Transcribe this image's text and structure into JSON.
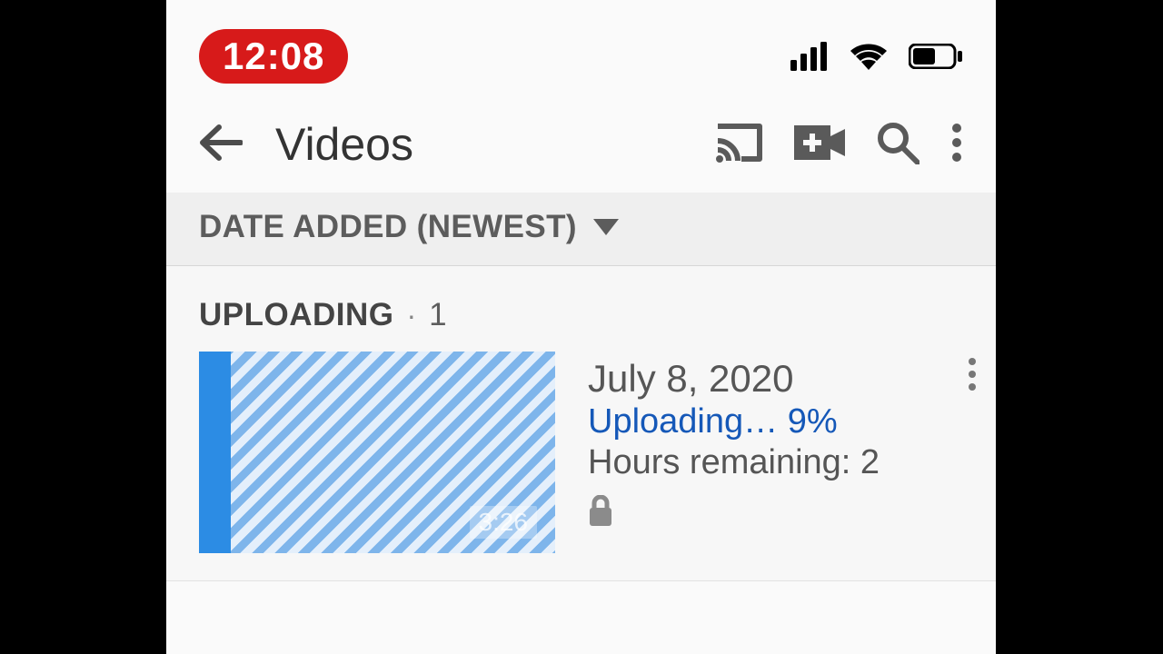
{
  "status_bar": {
    "time": "12:08"
  },
  "toolbar": {
    "title": "Videos"
  },
  "sort": {
    "label": "DATE ADDED (NEWEST)"
  },
  "uploading": {
    "label": "UPLOADING",
    "count": "1",
    "items": [
      {
        "title": "July 8, 2020",
        "status": "Uploading… 9%",
        "remaining": "Hours remaining: 2",
        "progress_pct": 9,
        "duration": "3:26"
      }
    ]
  }
}
